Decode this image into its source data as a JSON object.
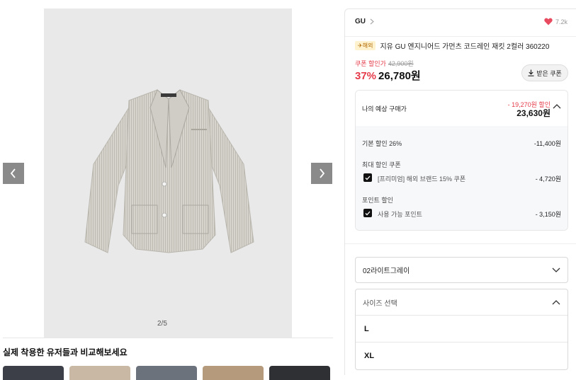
{
  "gallery": {
    "pager": "2/5",
    "compare_title": "실제 착용한 유저들과 비교해보세요",
    "icons": {
      "prev": "chevron-left-icon",
      "next": "chevron-right-icon"
    }
  },
  "product": {
    "brand": "GU",
    "likes": "7.2k",
    "overseas_badge": "✈해외",
    "title": "지유 GU 엔지니어드 가먼츠 코드레인 재킷 2컬러 360220",
    "coupon_label": "쿠폰 할인가",
    "original_price": "42,900원",
    "discount_rate": "37%",
    "sale_price": "26,780원",
    "coupon_button": "받은 쿠폰"
  },
  "estimate": {
    "label": "나의 예상 구매가",
    "diff": "- 19,270원 할인",
    "price": "23,630원",
    "base_discount_label": "기본 할인 26%",
    "base_discount_value": "-11,400원",
    "max_coupon_title": "최대 할인 쿠폰",
    "coupon_item": "[프리미엄] 해외 브랜드 15% 쿠폰",
    "coupon_value": "- 4,720원",
    "point_title": "포인트 할인",
    "point_item": "사용 가능 포인트",
    "point_value": "- 3,150원"
  },
  "options": {
    "color_selected": "02라이트그레이",
    "size_placeholder": "사이즈 선택",
    "sizes": [
      "L",
      "XL"
    ]
  },
  "colors": {
    "accent_red": "#e53b4a",
    "heart": "#e84a5f"
  }
}
